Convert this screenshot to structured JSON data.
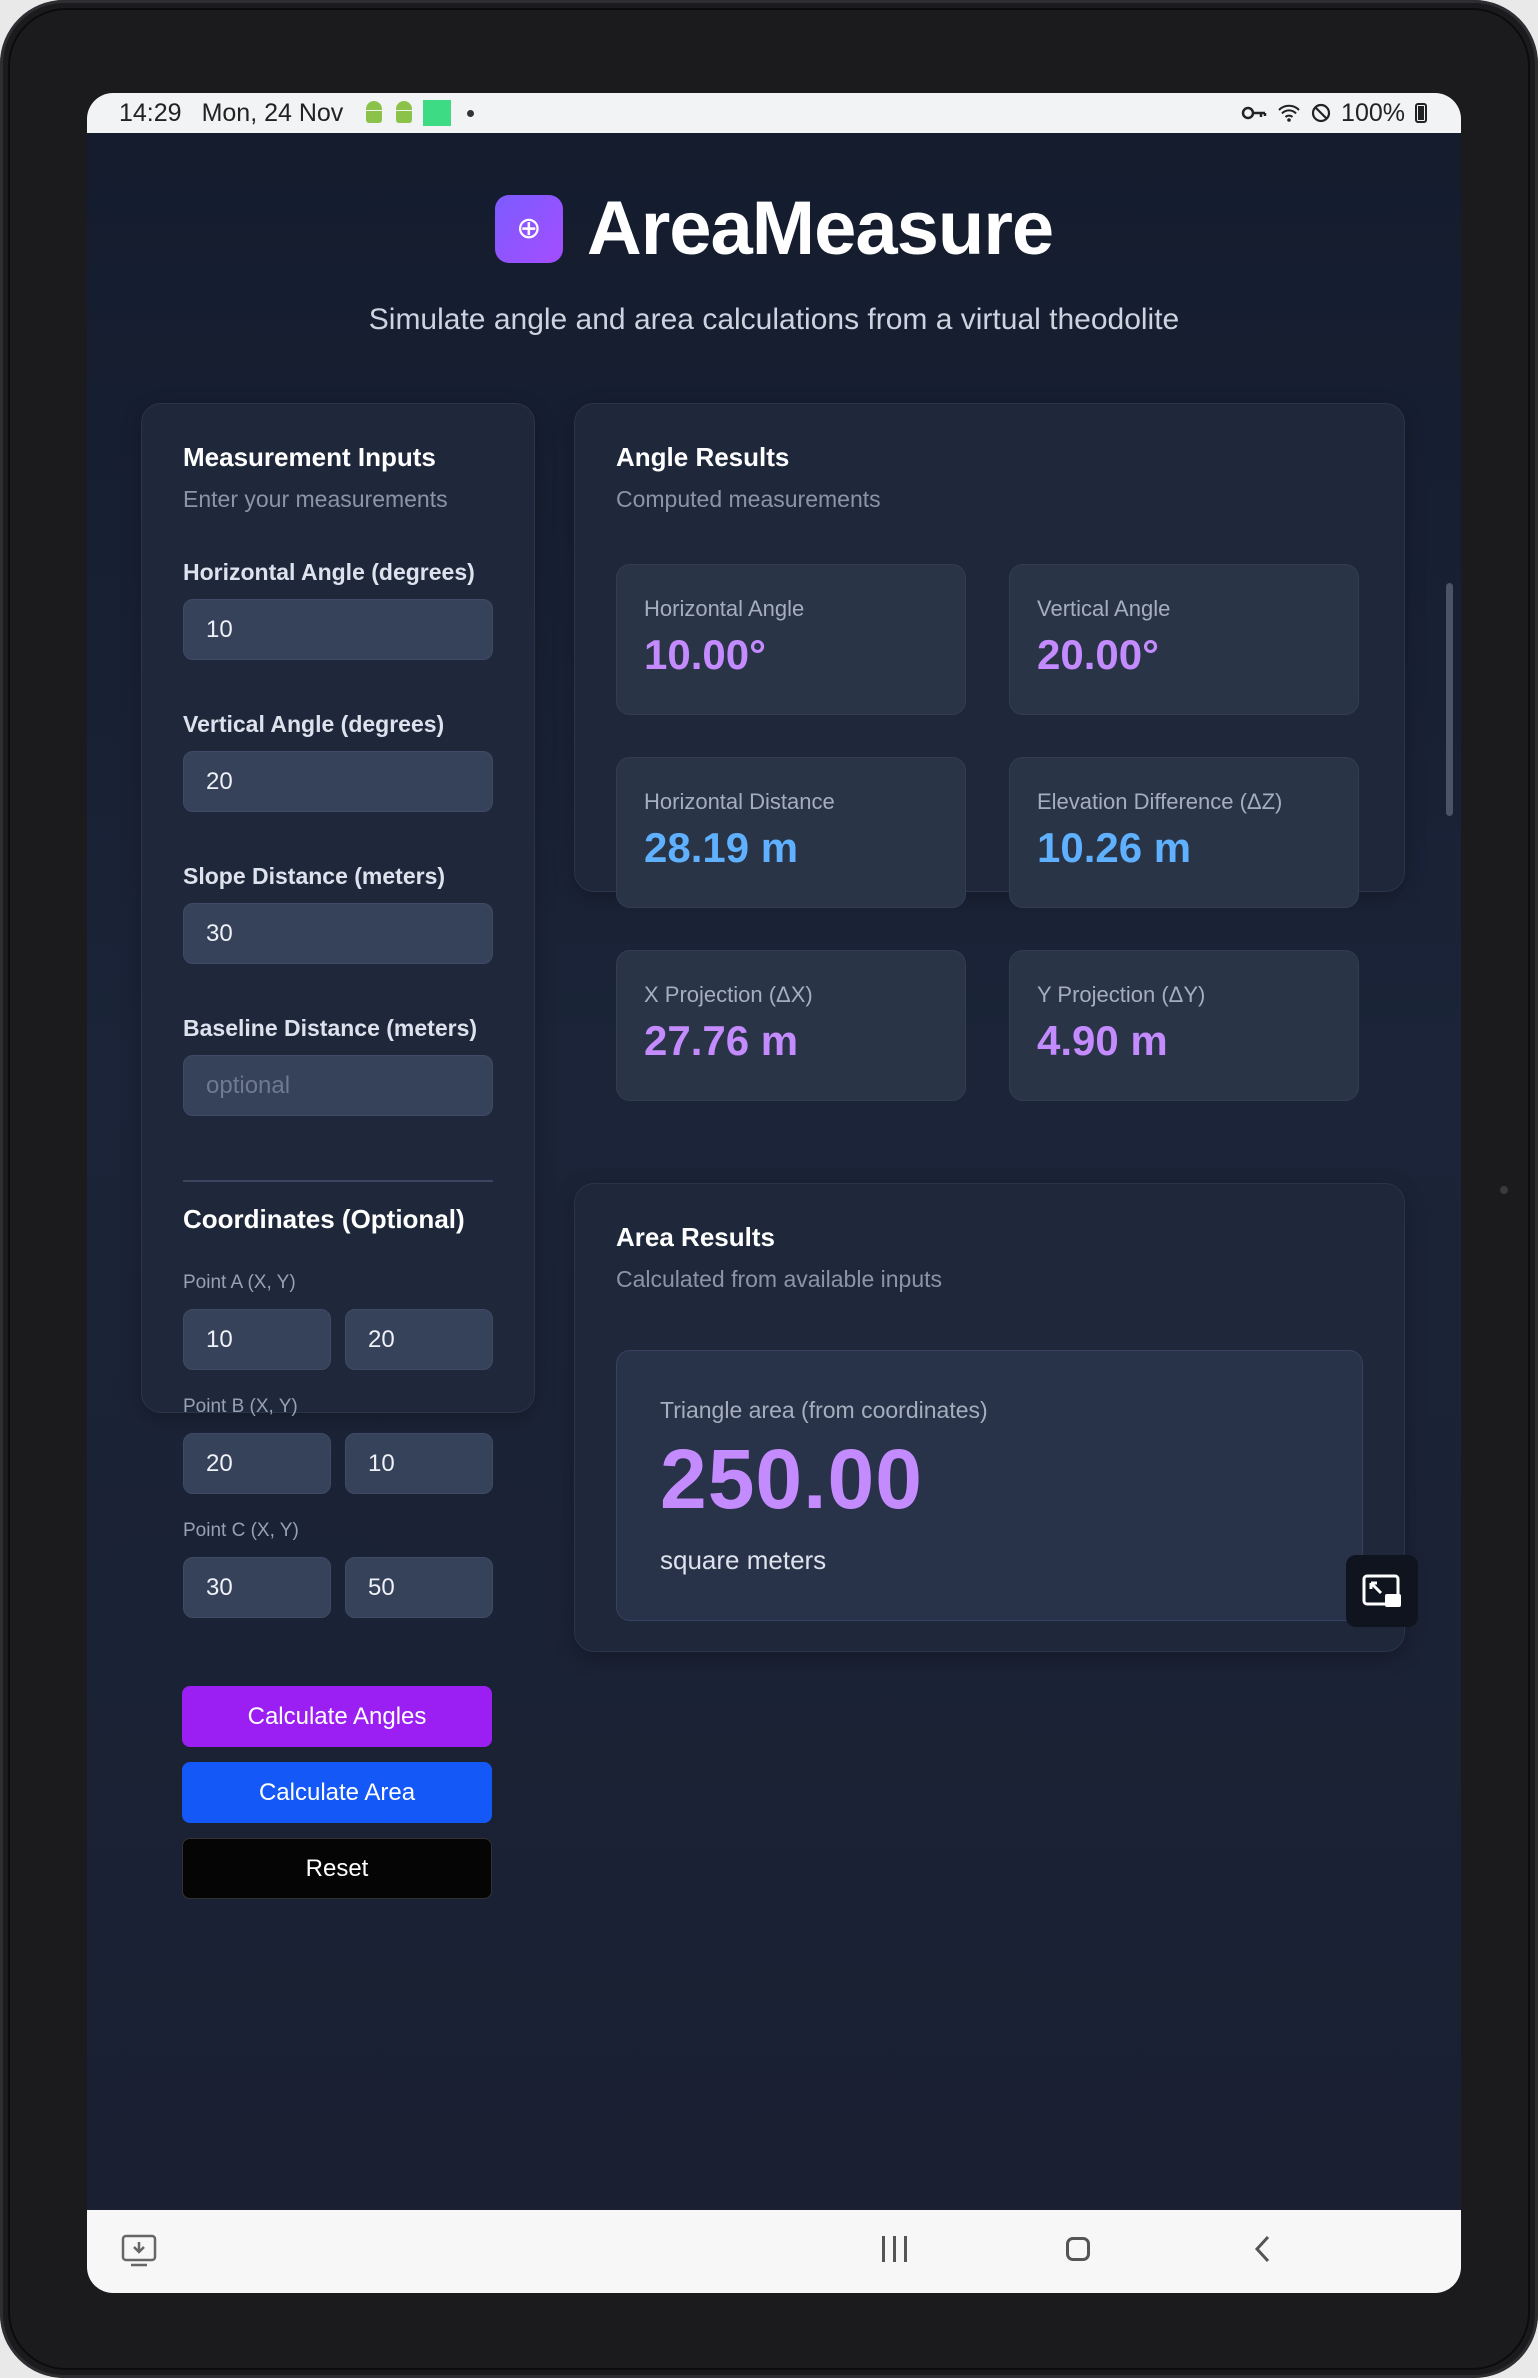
{
  "status_bar": {
    "time": "14:29",
    "date": "Mon, 24 Nov",
    "battery": "100%"
  },
  "header": {
    "logo_glyph": "⊕",
    "app_title": "AreaMeasure",
    "tagline": "Simulate angle and area calculations from a virtual theodolite"
  },
  "inputs_card": {
    "title": "Measurement Inputs",
    "subtitle": "Enter your measurements",
    "fields": [
      {
        "label": "Horizontal Angle (degrees)",
        "value": "10",
        "placeholder": ""
      },
      {
        "label": "Vertical Angle (degrees)",
        "value": "20",
        "placeholder": ""
      },
      {
        "label": "Slope Distance (meters)",
        "value": "30",
        "placeholder": ""
      },
      {
        "label": "Baseline Distance (meters)",
        "value": "",
        "placeholder": "optional"
      }
    ],
    "coords_title": "Coordinates (Optional)",
    "points": [
      {
        "label": "Point A (X, Y)",
        "x": "10",
        "y": "20"
      },
      {
        "label": "Point B (X, Y)",
        "x": "20",
        "y": "10"
      },
      {
        "label": "Point C (X, Y)",
        "x": "30",
        "y": "50"
      }
    ],
    "buttons": {
      "calc_angles": "Calculate Angles",
      "calc_area": "Calculate Area",
      "reset": "Reset"
    }
  },
  "angle_results": {
    "title": "Angle Results",
    "subtitle": "Computed measurements",
    "tiles": [
      {
        "label": "Horizontal Angle",
        "value": "10.00°"
      },
      {
        "label": "Vertical Angle",
        "value": "20.00°"
      },
      {
        "label": "Horizontal Distance",
        "value": "28.19 m"
      },
      {
        "label": "Elevation Difference (ΔZ)",
        "value": "10.26 m"
      },
      {
        "label": "X Projection (ΔX)",
        "value": "27.76 m"
      },
      {
        "label": "Y Projection (ΔY)",
        "value": "4.90 m"
      }
    ]
  },
  "area_results": {
    "title": "Area Results",
    "subtitle": "Calculated from available inputs",
    "label": "Triangle area (from coordinates)",
    "value": "250.00",
    "unit": "square meters"
  },
  "colors": {
    "purple_accent": "#9b1ff2",
    "blue_accent": "#1558f8",
    "value_purple": "#c48bff",
    "value_blue": "#5fb1ff",
    "background": "#141c2e"
  }
}
